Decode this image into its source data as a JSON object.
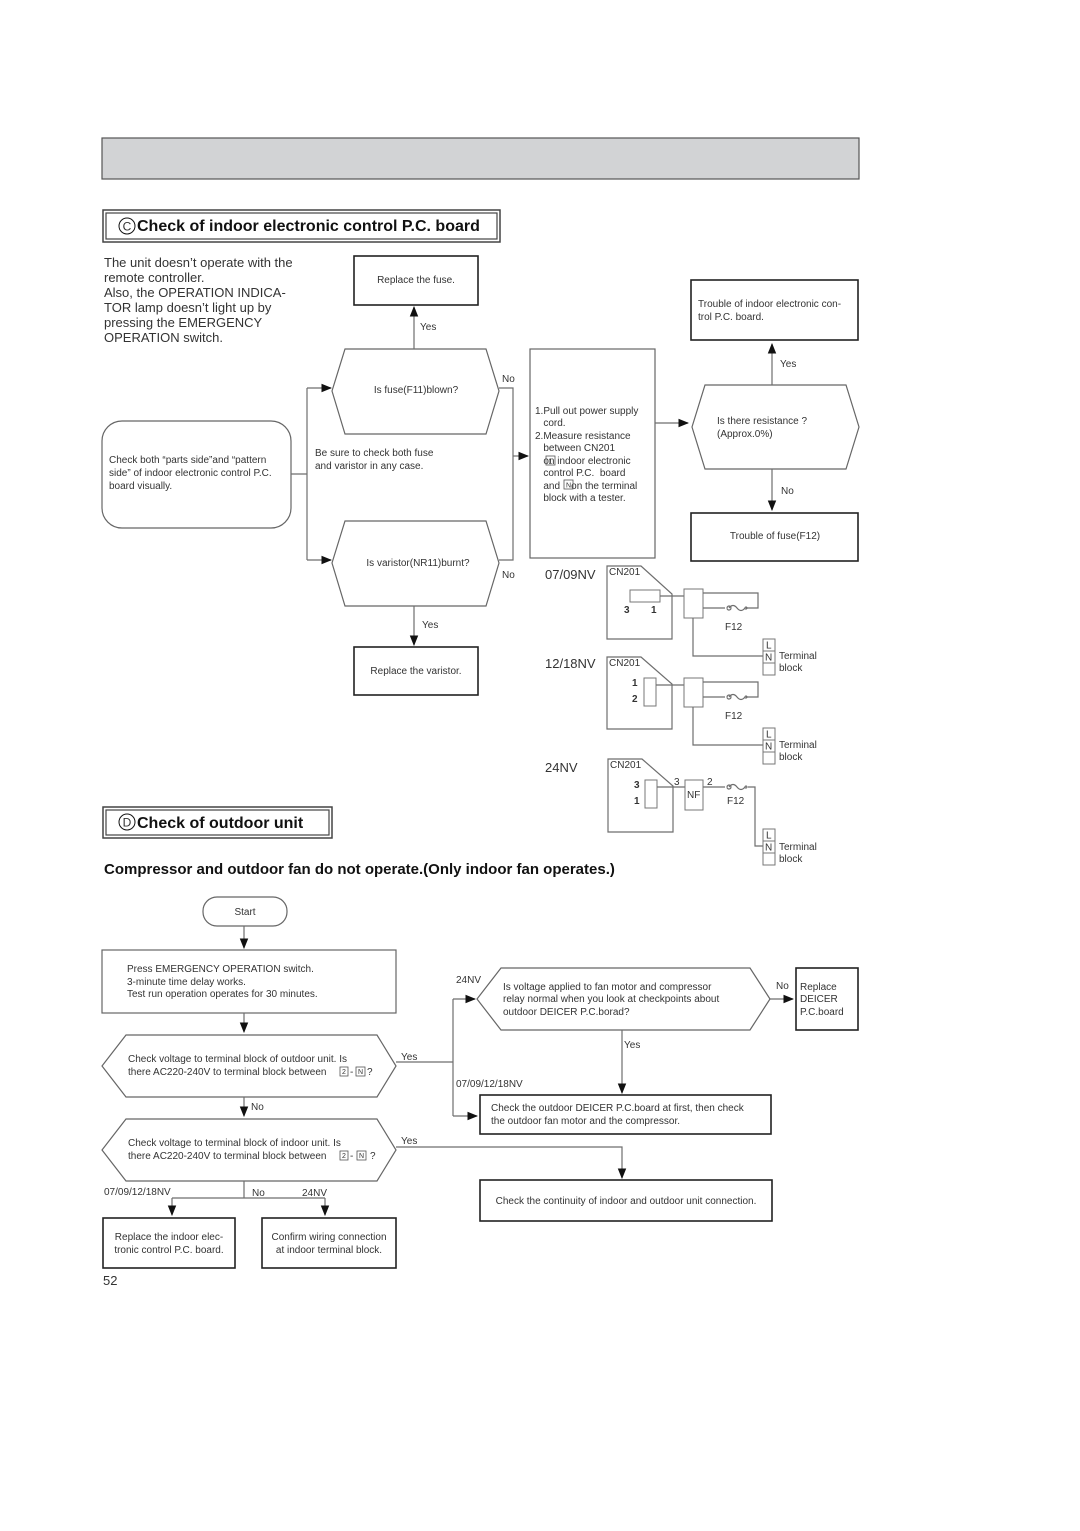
{
  "page": {
    "number": "52"
  },
  "header_bar": {
    "fill": "#d2d3d5"
  },
  "section_c": {
    "letter": "C",
    "title": "Check of indoor electronic control P.C. board",
    "symptom": [
      "The unit doesn’t operate with the",
      "remote controller.",
      "Also, the OPERATION INDICA-",
      "TOR lamp doesn’t light up by",
      "pressing the EMERGENCY",
      "OPERATION switch."
    ],
    "start_box": [
      "Check both “parts side”and “pattern",
      "side” of indoor electronic control P.C.",
      "board visually."
    ],
    "note": [
      "Be sure to check both fuse",
      "and varistor in any case."
    ],
    "q_fuse": "Is fuse(F11)blown?",
    "q_varistor": "Is varistor(NR11)burnt?",
    "replace_fuse": "Replace the fuse.",
    "replace_varistor": "Replace the varistor.",
    "yes": "Yes",
    "no": "No",
    "measure_box": [
      "1.Pull out power supply",
      "   cord.",
      "2.Measure resistance",
      "   between CN201",
      "   on indoor electronic",
      "   control P.C.  board",
      "   and    on the terminal",
      "   block with a tester."
    ],
    "measure_pin": "1",
    "measure_term": "N",
    "q_resistance": [
      "Is there resistance ?",
      "(Approx.0%)"
    ],
    "trouble_board": [
      "Trouble of indoor electronic con-",
      "trol P.C. board."
    ],
    "trouble_fuse": "Trouble of fuse(F12)",
    "wiring": [
      {
        "model": "07/09NV",
        "connector": "CN201",
        "pins": [
          "3",
          "1"
        ],
        "fuse": "F12"
      },
      {
        "model": "12/18NV",
        "connector": "CN201",
        "pins": [
          "1",
          "2"
        ],
        "fuse": "F12"
      },
      {
        "model": "24NV",
        "connector": "CN201",
        "pins": [
          "3",
          "1"
        ],
        "filter": "NF",
        "filter_pins": [
          "3",
          "2"
        ],
        "fuse": "F12"
      }
    ],
    "terminal": {
      "L": "L",
      "N": "N",
      "label1": "Terminal",
      "label2": "block"
    }
  },
  "section_d": {
    "letter": "D",
    "title": "Check of outdoor unit",
    "subtitle": "Compressor and outdoor fan do not operate.(Only indoor fan operates.)",
    "start": "Start",
    "step1": [
      "Press EMERGENCY OPERATION switch.",
      "3-minute time delay works.",
      "Test run operation operates for 30 minutes."
    ],
    "q_outdoor": [
      "Check voltage to terminal block of outdoor unit. Is",
      "there AC220-240V to terminal block between",
      "?"
    ],
    "q_indoor": [
      "Check voltage to terminal block of indoor unit. Is",
      "there AC220-240V to terminal block between",
      "?"
    ],
    "term_2": "2",
    "term_N": "N",
    "yes": "Yes",
    "no": "No",
    "label_24nv": "24NV",
    "label_small": "07/09/12/18NV",
    "q_deicer": [
      "Is voltage applied to fan motor and compressor",
      "relay normal when you look at checkpoints about",
      "outdoor DEICER P.C.borad?"
    ],
    "replace_deicer": [
      "Replace",
      "DEICER",
      "P.C.board"
    ],
    "check_deicer": [
      "Check the outdoor DEICER P.C.board at first, then check",
      "the outdoor fan motor and the compressor."
    ],
    "check_continuity": "Check the continuity of indoor and outdoor unit connection.",
    "replace_indoor": [
      "Replace the indoor elec-",
      "tronic control P.C. board."
    ],
    "confirm_wiring": [
      "Confirm wiring connection",
      "at indoor terminal block."
    ]
  }
}
